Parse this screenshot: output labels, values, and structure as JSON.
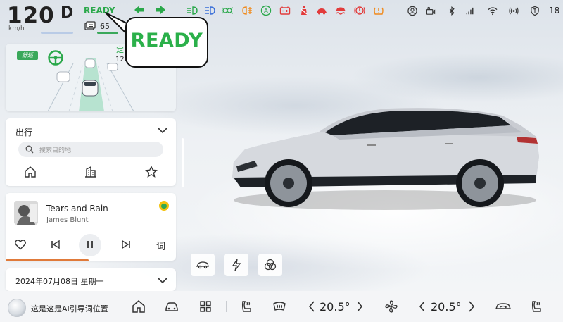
{
  "status": {
    "speed": "120",
    "speed_unit": "km/h",
    "gear": "D",
    "ready": "READY",
    "battery_range": "65",
    "time": "18"
  },
  "callout": {
    "text": "READY"
  },
  "adas": {
    "mode_badge": "舒适",
    "label": "定",
    "value": "120"
  },
  "trip": {
    "title": "出行",
    "search_placeholder": "搜索目的地"
  },
  "music": {
    "song": "Tears and Rain",
    "artist": "James Blunt",
    "lyrics_label": "词",
    "progress": 0.5
  },
  "date": {
    "text": "2024年07月08日 星期一"
  },
  "dock": {
    "ai_hint": "这是这是AI引导词位置",
    "left_temp": "20.5°",
    "right_temp": "20.5°"
  },
  "colors": {
    "ready_green": "#2aa84a",
    "warning_red": "#e23b3b",
    "warning_orange": "#f08a1c",
    "info_blue": "#3a6fd8"
  }
}
